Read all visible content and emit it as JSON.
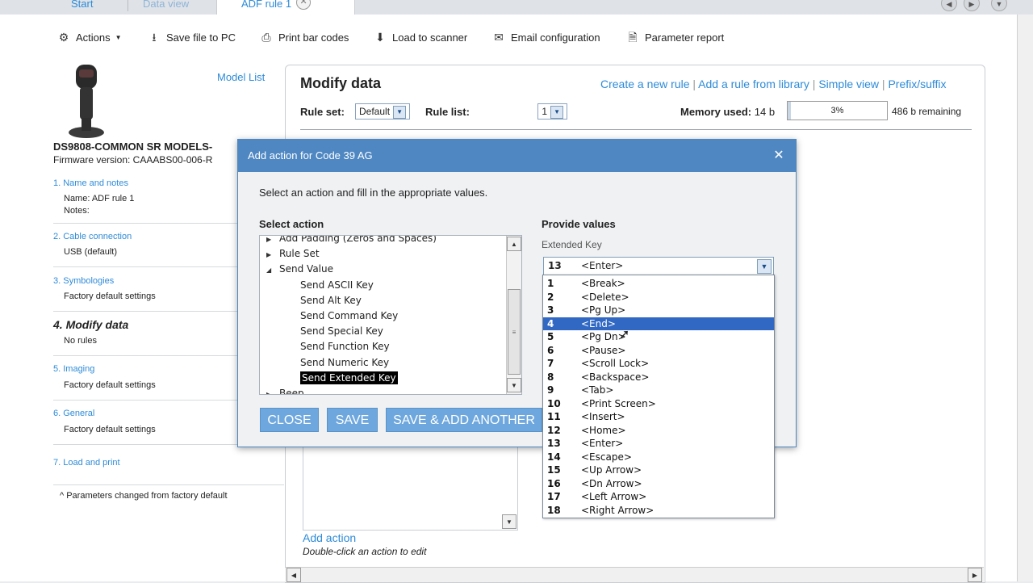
{
  "tabs": [
    {
      "label": "Start"
    },
    {
      "label": "Data view"
    },
    {
      "label": "ADF rule 1"
    }
  ],
  "toolbar": {
    "actions": "Actions",
    "save_file": "Save file to PC",
    "print_barcodes": "Print bar codes",
    "load_scanner": "Load to scanner",
    "email_config": "Email configuration",
    "param_report": "Parameter report"
  },
  "left": {
    "model_list": "Model List",
    "model_name": "DS9808-COMMON SR MODELS-",
    "firmware": "Firmware version: CAAABS00-006-R",
    "steps": [
      {
        "title": "1. Name and notes",
        "value": "Name: ADF rule 1",
        "value2": "Notes:"
      },
      {
        "title": "2. Cable connection",
        "value": "USB (default)"
      },
      {
        "title": "3. Symbologies",
        "value": "Factory default settings"
      },
      {
        "title": "4. Modify data",
        "value": "No rules"
      },
      {
        "title": "5. Imaging",
        "value": "Factory default settings"
      },
      {
        "title": "6. General",
        "value": "Factory default settings"
      },
      {
        "title": "7. Load and print",
        "value": ""
      }
    ],
    "footnote": "^ Parameters changed from factory default"
  },
  "content": {
    "title": "Modify data",
    "links": [
      "Create a new rule",
      "Add a rule from library",
      "Simple view",
      "Prefix/suffix"
    ],
    "rule_set_label": "Rule set:",
    "rule_set_value": "Default",
    "rule_list_label": "Rule list:",
    "rule_list_value": "1",
    "memory_label": "Memory used:",
    "memory_value": "14 b",
    "memory_percent": "3%",
    "memory_fraction": 0.03,
    "memory_remaining": "486 b remaining",
    "add_action": "Add action",
    "edit_hint": "Double-click an action to edit"
  },
  "dialog": {
    "title": "Add action for Code 39 AG",
    "instruction": "Select an action and fill in the appropriate values.",
    "select_action_label": "Select action",
    "provide_values_label": "Provide values",
    "field_label": "Extended Key",
    "field_value_num": "13",
    "field_value_key": "<Enter>",
    "tree": [
      {
        "label": "Add Padding (Zeros and Spaces)",
        "level": 0,
        "expander": "right"
      },
      {
        "label": "Rule Set",
        "level": 0,
        "expander": "right"
      },
      {
        "label": "Send Value",
        "level": 0,
        "expander": "down"
      },
      {
        "label": "Send ASCII Key",
        "level": 1
      },
      {
        "label": "Send Alt Key",
        "level": 1
      },
      {
        "label": "Send Command Key",
        "level": 1
      },
      {
        "label": "Send Special Key",
        "level": 1
      },
      {
        "label": "Send Function Key",
        "level": 1
      },
      {
        "label": "Send Numeric Key",
        "level": 1
      },
      {
        "label": "Send Extended Key",
        "level": 1,
        "selected": true
      },
      {
        "label": "Beep",
        "level": 0,
        "expander": "right"
      }
    ],
    "buttons": {
      "close": "CLOSE",
      "save": "SAVE",
      "save_add": "SAVE & ADD ANOTHER"
    },
    "options": [
      {
        "num": "1",
        "key": "<Break>"
      },
      {
        "num": "2",
        "key": "<Delete>"
      },
      {
        "num": "3",
        "key": "<Pg Up>"
      },
      {
        "num": "4",
        "key": "<End>",
        "selected": true
      },
      {
        "num": "5",
        "key": "<Pg Dn>"
      },
      {
        "num": "6",
        "key": "<Pause>"
      },
      {
        "num": "7",
        "key": "<Scroll Lock>"
      },
      {
        "num": "8",
        "key": "<Backspace>"
      },
      {
        "num": "9",
        "key": "<Tab>"
      },
      {
        "num": "10",
        "key": "<Print Screen>"
      },
      {
        "num": "11",
        "key": "<Insert>"
      },
      {
        "num": "12",
        "key": "<Home>"
      },
      {
        "num": "13",
        "key": "<Enter>"
      },
      {
        "num": "14",
        "key": "<Escape>"
      },
      {
        "num": "15",
        "key": "<Up Arrow>"
      },
      {
        "num": "16",
        "key": "<Dn Arrow>"
      },
      {
        "num": "17",
        "key": "<Left Arrow>"
      },
      {
        "num": "18",
        "key": "<Right Arrow>"
      }
    ]
  },
  "colors": {
    "accent": "#2e8bd8",
    "dialog_title": "#4f87c2",
    "button": "#6ea7dd",
    "selection": "#3168c4"
  }
}
